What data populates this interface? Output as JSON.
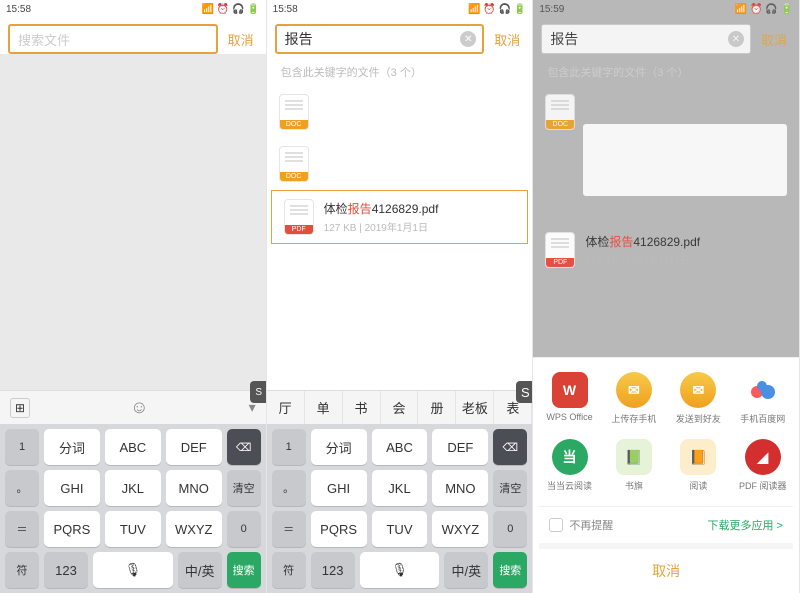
{
  "status": {
    "time": "15:58",
    "time3": "15:59",
    "signal": "3dl"
  },
  "search": {
    "placeholder": "搜索文件",
    "typed": "报告",
    "cancel": "取消"
  },
  "results": {
    "hint": "包含此关键字的文件（3 个）",
    "file": {
      "name_prefix": "体检",
      "name_highlight": "报告",
      "name_suffix": "4126829.pdf",
      "sub": "127 KB | 2019年1月1日",
      "icon_tag": "PDF",
      "generic_tag": "DOC"
    }
  },
  "keyboard": {
    "suggest": [
      "厅",
      "单",
      "书",
      "会",
      "册",
      "老板",
      "表"
    ],
    "r1": [
      "分词",
      "ABC",
      "DEF"
    ],
    "r2": [
      "GHI",
      "JKL",
      "MNO"
    ],
    "r3": [
      "PQRS",
      "TUV",
      "WXYZ"
    ],
    "side_top": "1",
    "backspace": "⌫",
    "clear": "清空",
    "zero": "0",
    "sym": "符",
    "num": "123",
    "mic": "🎤",
    "lang": "中/英",
    "search": "搜索"
  },
  "sheet": {
    "apps": [
      {
        "label": "WPS Office",
        "style": "red",
        "glyph": "W"
      },
      {
        "label": "上传存手机",
        "style": "yellow",
        "glyph": "✉"
      },
      {
        "label": "发送到好友",
        "style": "yellow2",
        "glyph": "✉"
      },
      {
        "label": "手机百度网",
        "style": "bluecloud",
        "glyph": "☁"
      },
      {
        "label": "当当云阅读",
        "style": "greenround",
        "glyph": "当"
      },
      {
        "label": "书旗",
        "style": "paleg",
        "glyph": "▭"
      },
      {
        "label": "阅读",
        "style": "paley",
        "glyph": "▭"
      },
      {
        "label": "PDF 阅读器",
        "style": "adobered",
        "glyph": "▲"
      }
    ],
    "noremind": "不再提醒",
    "more": "下载更多应用 >",
    "cancel": "取消"
  }
}
